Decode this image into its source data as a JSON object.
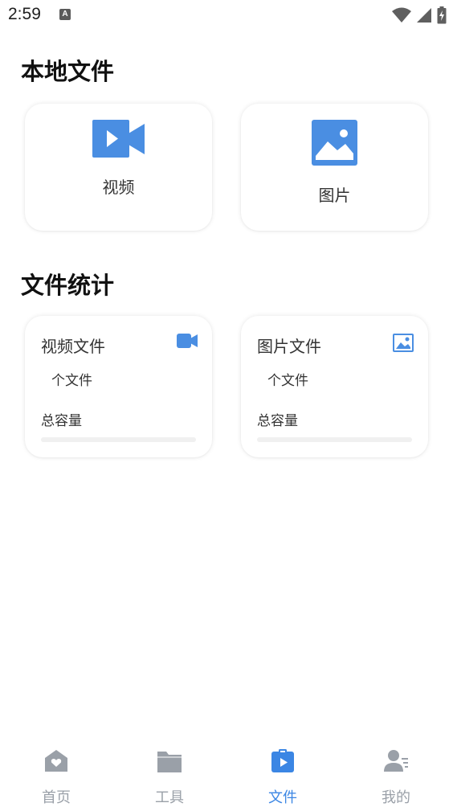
{
  "status_bar": {
    "time": "2:59",
    "notification_icon": "A"
  },
  "local_files": {
    "title": "本地文件",
    "cards": [
      {
        "label": "视频",
        "icon": "video-icon"
      },
      {
        "label": "图片",
        "icon": "image-icon"
      }
    ]
  },
  "stats": {
    "title": "文件统计",
    "cards": [
      {
        "title": "视频文件",
        "count_text": "个文件",
        "capacity_label": "总容量",
        "progress": 0,
        "icon": "video-icon"
      },
      {
        "title": "图片文件",
        "count_text": "个文件",
        "capacity_label": "总容量",
        "progress": 0,
        "icon": "image-icon"
      }
    ]
  },
  "tabbar": {
    "active": "文件",
    "items": [
      {
        "label": "首页",
        "icon": "home-icon"
      },
      {
        "label": "工具",
        "icon": "folder-icon"
      },
      {
        "label": "文件",
        "icon": "file-play-icon"
      },
      {
        "label": "我的",
        "icon": "profile-icon"
      }
    ]
  },
  "colors": {
    "accent": "#3b86e4",
    "icon_blue": "#4a8ee2",
    "tab_inactive": "#9aa0a8"
  }
}
